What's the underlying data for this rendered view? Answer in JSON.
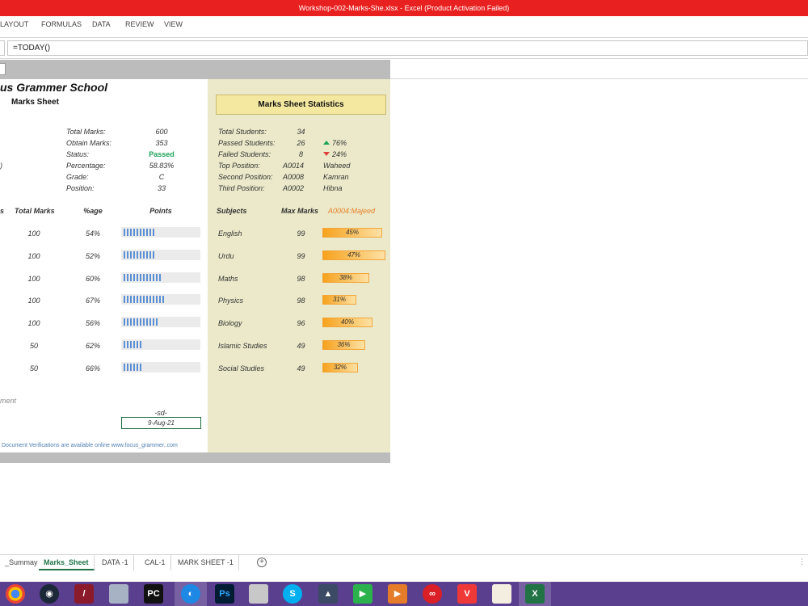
{
  "window": {
    "title": "Workshop-002-Marks-She.xlsx -  Excel (Product Activation Failed)"
  },
  "ribbon": {
    "tabs": [
      "LAYOUT",
      "FORMULAS",
      "DATA",
      "REVIEW",
      "VIEW"
    ]
  },
  "formula_bar": {
    "value": "=TODAY()"
  },
  "sheet": {
    "school": "us Grammer School",
    "subtitle": "Marks Sheet",
    "left_stub": ")",
    "summary": [
      {
        "label": "Total Marks:",
        "value": "600"
      },
      {
        "label": "Obtain Marks:",
        "value": "353"
      },
      {
        "label": "Status:",
        "value": "Passed"
      },
      {
        "label": "Percentage:",
        "value": "58.83%"
      },
      {
        "label": "Grade:",
        "value": "C"
      },
      {
        "label": "Position:",
        "value": "33"
      }
    ],
    "table_headers": {
      "s": "s",
      "total": "Total Marks",
      "age": "%age",
      "points": "Points"
    },
    "rows": [
      {
        "total": "100",
        "pct": "54%",
        "points": 10
      },
      {
        "total": "100",
        "pct": "52%",
        "points": 10
      },
      {
        "total": "100",
        "pct": "60%",
        "points": 12
      },
      {
        "total": "100",
        "pct": "67%",
        "points": 13
      },
      {
        "total": "100",
        "pct": "56%",
        "points": 11
      },
      {
        "total": "50",
        "pct": "62%",
        "points": 6
      },
      {
        "total": "50",
        "pct": "66%",
        "points": 6
      }
    ],
    "comment_label": "ment",
    "signature": {
      "label": "-sd-",
      "date": "9-Aug-21"
    },
    "footer_note": "Document Verifications are available online www.focus_grammer..com"
  },
  "stats": {
    "header": "Marks Sheet Statistics",
    "items": [
      {
        "label": "Total Students:",
        "value": "34",
        "extra": ""
      },
      {
        "label": "Passed Students:",
        "value": "26",
        "extra": "76%"
      },
      {
        "label": "Failed Students:",
        "value": "8",
        "extra": "24%"
      },
      {
        "label": "Top Position:",
        "value": "A0014",
        "extra": "Waheed"
      },
      {
        "label": "Second Position:",
        "value": "A0008",
        "extra": "Kamran"
      },
      {
        "label": "Third Position:",
        "value": "A0002",
        "extra": "Hibna"
      }
    ],
    "subject_header": "Subjects",
    "max_header": "Max Marks",
    "student_header": "A0004:Majeed",
    "subjects": [
      {
        "name": "English",
        "max": "99",
        "pct": "45%",
        "fill": 0.45
      },
      {
        "name": "Urdu",
        "max": "99",
        "pct": "47%",
        "fill": 0.47
      },
      {
        "name": "Maths",
        "max": "98",
        "pct": "38%",
        "fill": 0.38
      },
      {
        "name": "Physics",
        "max": "98",
        "pct": "31%",
        "fill": 0.31
      },
      {
        "name": "Biology",
        "max": "96",
        "pct": "40%",
        "fill": 0.4
      },
      {
        "name": "Islamic Studies",
        "max": "49",
        "pct": "36%",
        "fill": 0.36
      },
      {
        "name": "Social Studies",
        "max": "49",
        "pct": "32%",
        "fill": 0.32
      }
    ],
    "colors": {
      "up": "#1aa257",
      "down": "#e0403a",
      "student": "#e8812b"
    }
  },
  "sheet_tabs": [
    "_Summay",
    "Marks_Sheet",
    "DATA -1",
    "CAL-1",
    "MARK SHEET -1"
  ],
  "active_tab": "Marks_Sheet",
  "taskbar": {
    "icons": [
      "chrome-icon",
      "steam-icon",
      "app-icon",
      "photos-icon",
      "pycharm-icon",
      "browser-icon",
      "photoshop-icon",
      "files-icon",
      "skype-icon",
      "editor-icon",
      "media-icon",
      "player-icon",
      "creative-cloud-icon",
      "vivaldi-icon",
      "book-icon",
      "excel-icon"
    ],
    "labels": {
      "pycharm": "PC",
      "photoshop": "Ps",
      "skype": "S",
      "excel": "X"
    }
  }
}
